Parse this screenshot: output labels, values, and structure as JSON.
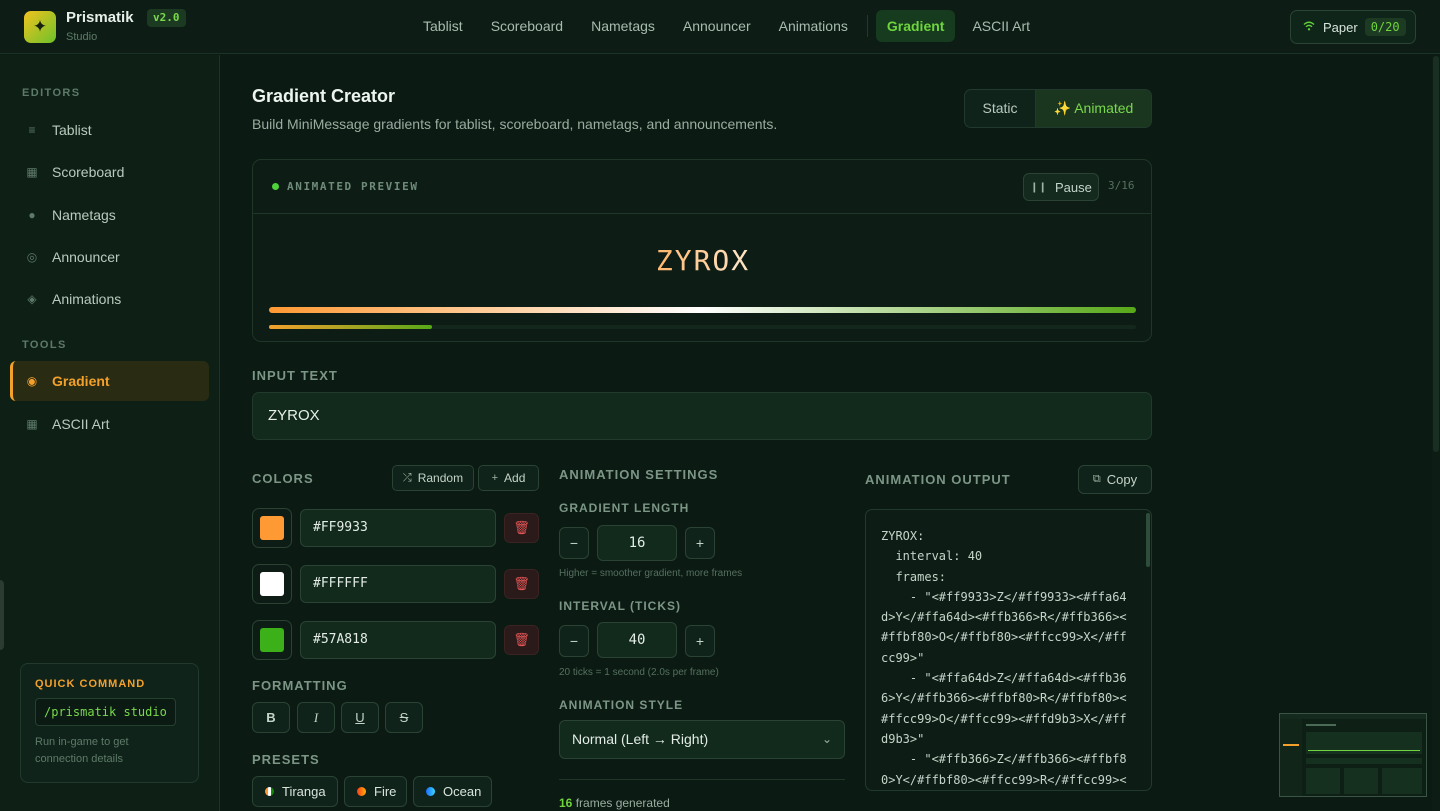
{
  "brand": {
    "name": "Prismatik",
    "version": "v2.0",
    "subtitle": "Studio"
  },
  "nav": {
    "items": [
      {
        "label": "Tablist",
        "active": false
      },
      {
        "label": "Scoreboard",
        "active": false
      },
      {
        "label": "Nametags",
        "active": false
      },
      {
        "label": "Announcer",
        "active": false
      },
      {
        "label": "Animations",
        "active": false
      },
      {
        "label": "Gradient",
        "active": true
      },
      {
        "label": "ASCII Art",
        "active": false
      }
    ]
  },
  "server": {
    "name": "Paper",
    "players": "0/20",
    "icon": "wifi-icon"
  },
  "sidebar": {
    "editors_heading": "EDITORS",
    "editors": [
      {
        "label": "Tablist",
        "icon": "list-icon"
      },
      {
        "label": "Scoreboard",
        "icon": "grid-icon"
      },
      {
        "label": "Nametags",
        "icon": "tag-icon"
      },
      {
        "label": "Announcer",
        "icon": "megaphone-icon"
      },
      {
        "label": "Animations",
        "icon": "diamond-icon"
      }
    ],
    "tools_heading": "TOOLS",
    "tools": [
      {
        "label": "Gradient",
        "icon": "palette-icon",
        "active": true
      },
      {
        "label": "ASCII Art",
        "icon": "grid-icon",
        "active": false
      }
    ],
    "quick_command": {
      "title": "QUICK COMMAND",
      "command": "/prismatik studio",
      "note": "Run in-game to get connection details"
    }
  },
  "page": {
    "title": "Gradient Creator",
    "subtitle": "Build MiniMessage gradients for tablist, scoreboard, nametags, and announcements.",
    "modes": {
      "static": "Static",
      "animated": "✨ Animated",
      "selected": "animated"
    }
  },
  "preview": {
    "label": "ANIMATED PREVIEW",
    "pause_label": "Pause",
    "frame_counter": "3/16",
    "letters": [
      "Z",
      "Y",
      "R",
      "O",
      "X"
    ],
    "progress": 0.1875
  },
  "input": {
    "label": "INPUT TEXT",
    "value": "ZYROX"
  },
  "colors": {
    "label": "COLORS",
    "random_label": "Random",
    "add_label": "Add",
    "items": [
      {
        "hex": "#FF9933",
        "swatch": "#ff9933"
      },
      {
        "hex": "#FFFFFF",
        "swatch": "#ffffff"
      },
      {
        "hex": "#57A818",
        "swatch": "#3cb019"
      }
    ]
  },
  "formatting": {
    "label": "FORMATTING",
    "buttons": [
      {
        "label": "B",
        "name": "bold"
      },
      {
        "label": "I",
        "name": "italic"
      },
      {
        "label": "U",
        "name": "underline"
      },
      {
        "label": "S",
        "name": "strikethrough"
      }
    ]
  },
  "presets": {
    "label": "PRESETS",
    "items": [
      {
        "label": "Tiranga"
      },
      {
        "label": "Fire"
      },
      {
        "label": "Ocean"
      }
    ]
  },
  "animation_settings": {
    "label": "ANIMATION SETTINGS",
    "gradient_length": {
      "label": "GRADIENT LENGTH",
      "value": "16",
      "hint": "Higher = smoother gradient, more frames"
    },
    "interval": {
      "label": "INTERVAL (TICKS)",
      "value": "40",
      "hint": "20 ticks = 1 second (2.0s per frame)"
    },
    "style": {
      "label": "ANIMATION STYLE",
      "value": "Normal (Left → Right)"
    },
    "frames_count": "16",
    "frames_text": "frames generated",
    "decrement": "−",
    "increment": "+"
  },
  "output": {
    "label": "ANIMATION OUTPUT",
    "copy_label": "Copy",
    "code": "ZYROX:\n  interval: 40\n  frames:\n    - \"<#ff9933>Z</#ff9933><#ffa64d>Y</#ffa64d><#ffb366>R</#ffb366><#ffbf80>O</#ffbf80><#ffcc99>X</#ffcc99>\"\n    - \"<#ffa64d>Z</#ffa64d><#ffb366>Y</#ffb366><#ffbf80>R</#ffbf80><#ffcc99>O</#ffcc99><#ffd9b3>X</#ffd9b3>\"\n    - \"<#ffb366>Z</#ffb366><#ffbf80>Y</#ffbf80><#ffcc99>R</#ffcc99><"
  },
  "theme": {
    "accent": "#6fd43d",
    "tool_accent": "#f4a12c",
    "background": "#0b1a13",
    "danger": "#e25555"
  }
}
